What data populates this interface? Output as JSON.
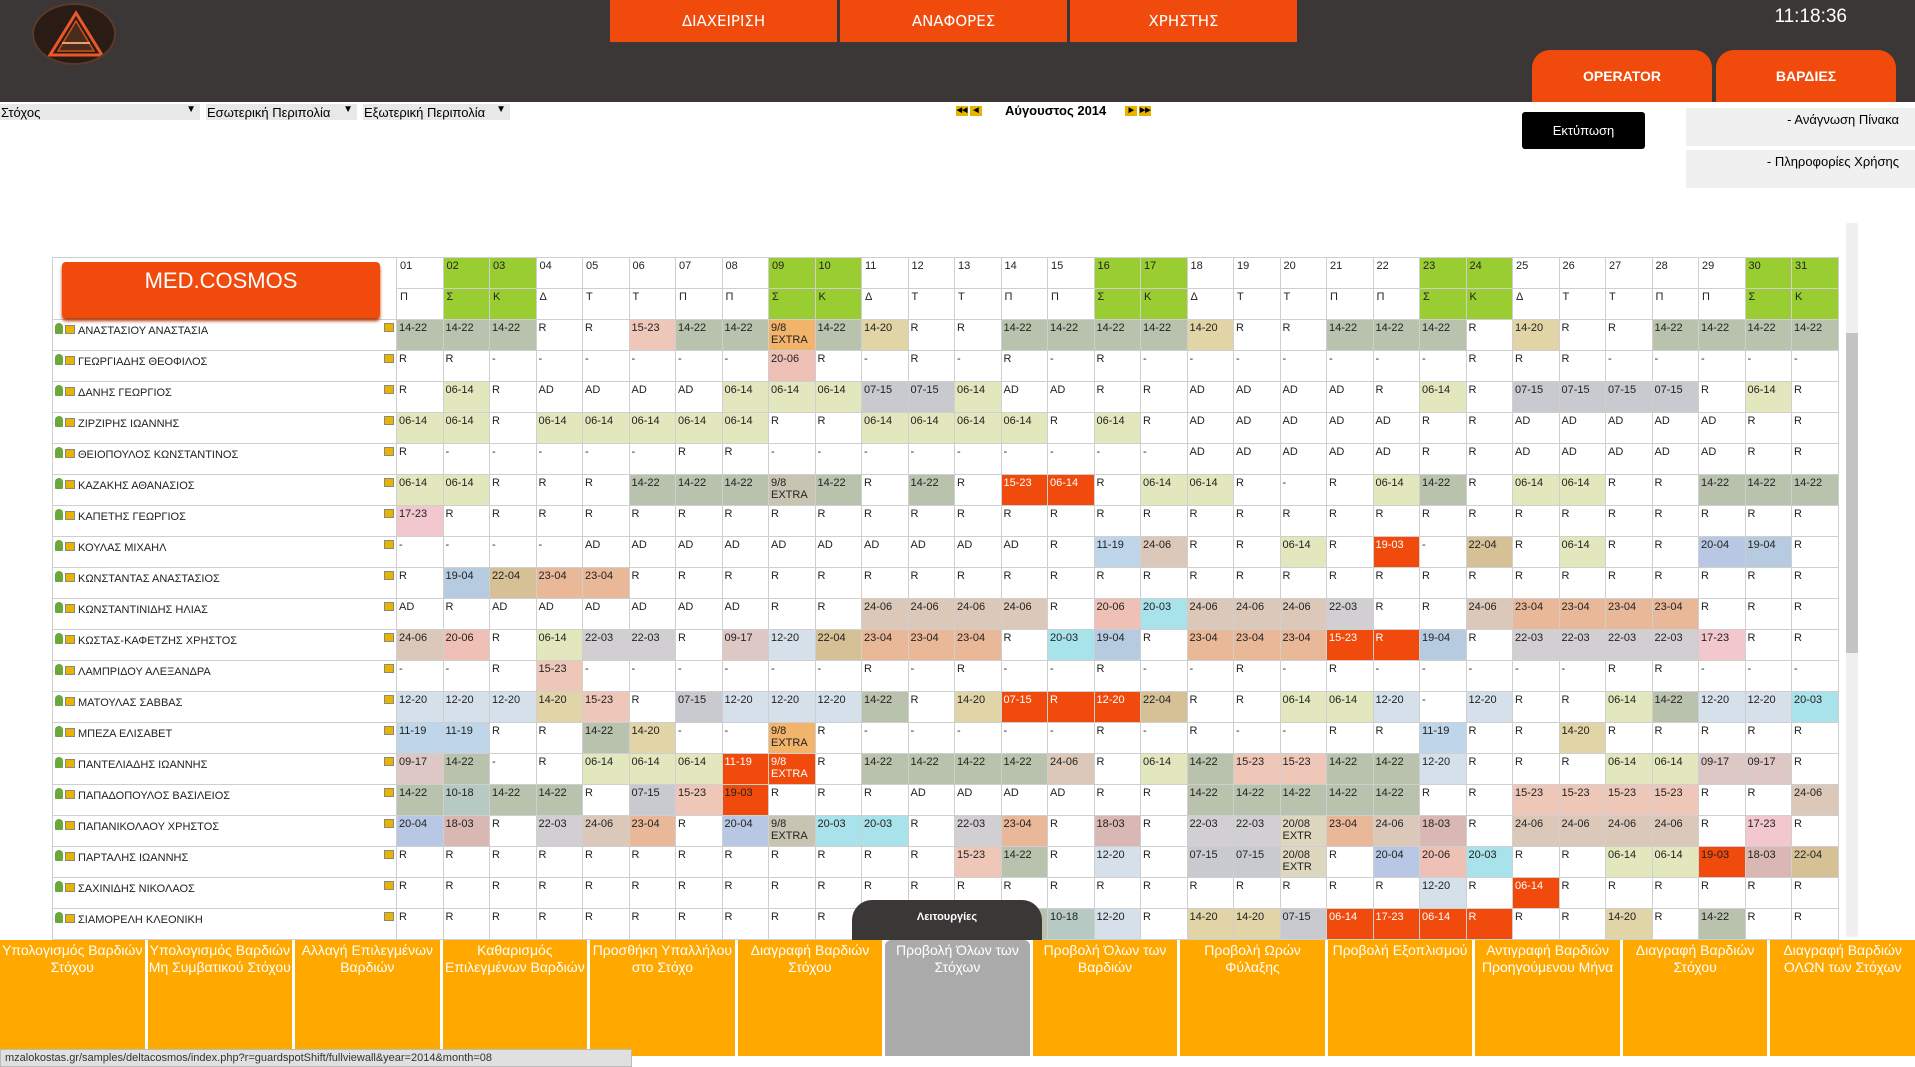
{
  "header": {
    "nav": [
      "ΔΙΑΧΕΙΡΙΣΗ",
      "ΑΝΑΦΟΡΕΣ",
      "ΧΡΗΣΤΗΣ"
    ],
    "clock": "11:18:36",
    "tab_operator": "OPERATOR",
    "tab_shifts": "ΒΑΡΔΙΕΣ"
  },
  "filters": {
    "target": "Στόχος",
    "internal": "Εσωτερική Περιπολία",
    "external": "Εξωτερική Περιπολία"
  },
  "month": "Αύγουστος 2014",
  "print_label": "Εκτύπωση",
  "right_panel": {
    "read_table": "- Ανάγνωση Πίνακα",
    "usage_info": "- Πληροφορίες Χρήσης"
  },
  "brand": "MED.COSMOS",
  "colors": {
    "orange": "#f04a0c",
    "weekend": "#9acd32",
    "button": "#ffa800",
    "dark": "#3a3736"
  },
  "days": [
    "01",
    "02",
    "03",
    "04",
    "05",
    "06",
    "07",
    "08",
    "09",
    "10",
    "11",
    "12",
    "13",
    "14",
    "15",
    "16",
    "17",
    "18",
    "19",
    "20",
    "21",
    "22",
    "23",
    "24",
    "25",
    "26",
    "27",
    "28",
    "29",
    "30",
    "31"
  ],
  "weekdays": [
    "Π",
    "Σ",
    "Κ",
    "Δ",
    "Τ",
    "Τ",
    "Π",
    "Π",
    "Σ",
    "Κ",
    "Δ",
    "Τ",
    "Τ",
    "Π",
    "Π",
    "Σ",
    "Κ",
    "Δ",
    "Τ",
    "Τ",
    "Π",
    "Π",
    "Σ",
    "Κ",
    "Δ",
    "Τ",
    "Τ",
    "Π",
    "Π",
    "Σ",
    "Κ"
  ],
  "weekend_cols": [
    1,
    2,
    8,
    9,
    15,
    16,
    22,
    23,
    29,
    30
  ],
  "employees": [
    {
      "name": "ΑΝΑΣΤΑΣΙΟΥ ΑΝΑΣΤΑΣΙΑ",
      "cells": [
        "14-22",
        "14-22",
        "14-22",
        "R",
        "R",
        "15-23",
        "14-22",
        "14-22",
        "9/8|EXTRA",
        "14-22",
        "14-20",
        "R",
        "R",
        "14-22",
        "14-22",
        "14-22",
        "14-22",
        "14-20",
        "R",
        "R",
        "14-22",
        "14-22",
        "14-22",
        "R",
        "14-20",
        "R",
        "R",
        "14-22",
        "14-22",
        "14-22",
        "14-22"
      ]
    },
    {
      "name": "ΓΕΩΡΓΙΑΔΗΣ ΘΕΟΦΙΛΟΣ",
      "cells": [
        "R",
        "R",
        "-",
        "-",
        "-",
        "-",
        "-",
        "-",
        "20-06",
        "R",
        "-",
        "R",
        "-",
        "R",
        "-",
        "R",
        "-",
        "-",
        "-",
        "-",
        "-",
        "-",
        "-",
        "R",
        "R",
        "R",
        "-",
        "-",
        "-",
        "-",
        "-"
      ]
    },
    {
      "name": "ΔΑΝΗΣ ΓΕΩΡΓΙΟΣ",
      "cells": [
        "R",
        "06-14",
        "R",
        "AD",
        "AD",
        "AD",
        "AD",
        "06-14",
        "06-14",
        "06-14",
        "07-15",
        "07-15",
        "06-14",
        "AD",
        "AD",
        "R",
        "R",
        "AD",
        "AD",
        "AD",
        "AD",
        "R",
        "06-14",
        "R",
        "07-15",
        "07-15",
        "07-15",
        "07-15",
        "R",
        "06-14",
        "R"
      ]
    },
    {
      "name": "ΖΙΡΖΙΡΗΣ ΙΩΑΝΝΗΣ",
      "cells": [
        "06-14",
        "06-14",
        "R",
        "06-14",
        "06-14",
        "06-14",
        "06-14",
        "06-14",
        "R",
        "R",
        "06-14",
        "06-14",
        "06-14",
        "06-14",
        "R",
        "06-14",
        "R",
        "AD",
        "AD",
        "AD",
        "AD",
        "AD",
        "R",
        "R",
        "AD",
        "AD",
        "AD",
        "AD",
        "AD",
        "R",
        "R"
      ]
    },
    {
      "name": "ΘΕΙΟΠΟΥΛΟΣ ΚΩΝΣΤΑΝΤΙΝΟΣ",
      "cells": [
        "R",
        "-",
        "-",
        "-",
        "-",
        "-",
        "R",
        "R",
        "-",
        "-",
        "-",
        "-",
        "-",
        "-",
        "-",
        "-",
        "-",
        "AD",
        "AD",
        "AD",
        "AD",
        "AD",
        "R",
        "R",
        "AD",
        "AD",
        "AD",
        "AD",
        "AD",
        "R",
        "R"
      ]
    },
    {
      "name": "ΚΑΖΑΚΗΣ ΑΘΑΝΑΣΙΟΣ",
      "cells": [
        "06-14",
        "06-14",
        "R",
        "R",
        "R",
        "14-22",
        "14-22",
        "14-22",
        "9/8|EXTRA",
        "14-22",
        "R",
        "14-22",
        "R",
        "15-23",
        "06-14",
        "R",
        "06-14",
        "06-14",
        "R",
        "-",
        "R",
        "06-14",
        "14-22",
        "R",
        "06-14",
        "06-14",
        "R",
        "R",
        "14-22",
        "14-22",
        "14-22"
      ]
    },
    {
      "name": "ΚΑΠΕΤΗΣ ΓΕΩΡΓΙΟΣ",
      "cells": [
        "17-23",
        "R",
        "R",
        "R",
        "R",
        "R",
        "R",
        "R",
        "R",
        "R",
        "R",
        "R",
        "R",
        "R",
        "R",
        "R",
        "R",
        "R",
        "R",
        "R",
        "R",
        "R",
        "R",
        "R",
        "R",
        "R",
        "R",
        "R",
        "R",
        "R",
        "R"
      ]
    },
    {
      "name": "ΚΟΥΛΑΣ ΜΙΧΑΗΛ",
      "cells": [
        "-",
        "-",
        "-",
        "-",
        "AD",
        "AD",
        "AD",
        "AD",
        "AD",
        "AD",
        "AD",
        "AD",
        "AD",
        "AD",
        "R",
        "11-19",
        "24-06",
        "R",
        "R",
        "06-14",
        "R",
        "19-03",
        "-",
        "22-04",
        "R",
        "06-14",
        "R",
        "R",
        "20-04",
        "19-04",
        "R"
      ]
    },
    {
      "name": "ΚΩΝΣΤΑΝΤΑΣ ΑΝΑΣΤΑΣΙΟΣ",
      "cells": [
        "R",
        "19-04",
        "22-04",
        "23-04",
        "23-04",
        "R",
        "R",
        "R",
        "R",
        "R",
        "R",
        "R",
        "R",
        "R",
        "R",
        "R",
        "R",
        "R",
        "R",
        "R",
        "R",
        "R",
        "R",
        "R",
        "R",
        "R",
        "R",
        "R",
        "R",
        "R",
        "R"
      ]
    },
    {
      "name": "ΚΩΝΣΤΑΝΤΙΝΙΔΗΣ ΗΛΙΑΣ",
      "cells": [
        "AD",
        "R",
        "AD",
        "AD",
        "AD",
        "AD",
        "AD",
        "AD",
        "R",
        "R",
        "24-06",
        "24-06",
        "24-06",
        "24-06",
        "R",
        "20-06",
        "20-03",
        "24-06",
        "24-06",
        "24-06",
        "22-03",
        "R",
        "R",
        "24-06",
        "23-04",
        "23-04",
        "23-04",
        "23-04",
        "R",
        "R",
        "R"
      ]
    },
    {
      "name": "ΚΩΣΤΑΣ-ΚΑΦΕΤΖΗΣ ΧΡΗΣΤΟΣ",
      "cells": [
        "24-06",
        "20-06",
        "R",
        "06-14",
        "22-03",
        "22-03",
        "R",
        "09-17",
        "12-20",
        "22-04",
        "23-04",
        "23-04",
        "23-04",
        "R",
        "20-03",
        "19-04",
        "R",
        "23-04",
        "23-04",
        "23-04",
        "15-23",
        "R",
        "19-04",
        "R",
        "22-03",
        "22-03",
        "22-03",
        "22-03",
        "17-23",
        "R",
        "R"
      ]
    },
    {
      "name": "ΛΑΜΠΡΙΔΟΥ ΑΛΕΞΑΝΔΡΑ",
      "cells": [
        "-",
        "-",
        "R",
        "15-23",
        "-",
        "-",
        "-",
        "-",
        "-",
        "-",
        "R",
        "-",
        "R",
        "-",
        "-",
        "R",
        "-",
        "-",
        "R",
        "-",
        "R",
        "-",
        "-",
        "-",
        "-",
        "-",
        "R",
        "R",
        "-",
        "-",
        "-"
      ]
    },
    {
      "name": "ΜΑΤΟΥΛΑΣ ΣΑΒΒΑΣ",
      "cells": [
        "12-20",
        "12-20",
        "12-20",
        "14-20",
        "15-23",
        "R",
        "07-15",
        "12-20",
        "12-20",
        "12-20",
        "14-22",
        "R",
        "14-20",
        "07-15",
        "R",
        "12-20",
        "22-04",
        "R",
        "R",
        "06-14",
        "06-14",
        "12-20",
        "-",
        "12-20",
        "R",
        "R",
        "06-14",
        "14-22",
        "12-20",
        "12-20",
        "20-03"
      ]
    },
    {
      "name": "ΜΠΕΖΑ ΕΛΙΣΑΒΕΤ",
      "cells": [
        "11-19",
        "11-19",
        "R",
        "R",
        "14-22",
        "14-20",
        "-",
        "-",
        "9/8|EXTRA",
        "R",
        "-",
        "-",
        "-",
        "-",
        "-",
        "R",
        "-",
        "R",
        "-",
        "-",
        "R",
        "R",
        "11-19",
        "R",
        "R",
        "14-20",
        "R",
        "R",
        "R",
        "R",
        "R"
      ]
    },
    {
      "name": "ΠΑΝΤΕΛΙΑΔΗΣ ΙΩΑΝΝΗΣ",
      "cells": [
        "09-17",
        "14-22",
        "-",
        "R",
        "06-14",
        "06-14",
        "06-14",
        "11-19",
        "9/8|EXTRA",
        "R",
        "14-22",
        "14-22",
        "14-22",
        "14-22",
        "24-06",
        "R",
        "06-14",
        "14-22",
        "15-23",
        "15-23",
        "14-22",
        "14-22",
        "12-20",
        "R",
        "R",
        "R",
        "06-14",
        "06-14",
        "09-17",
        "09-17",
        "R"
      ]
    },
    {
      "name": "ΠΑΠΑΔΟΠΟΥΛΟΣ ΒΑΣΙΛΕΙΟΣ",
      "cells": [
        "14-22",
        "10-18",
        "14-22",
        "14-22",
        "R",
        "07-15",
        "15-23",
        "19-03",
        "R",
        "R",
        "R",
        "AD",
        "AD",
        "AD",
        "AD",
        "R",
        "R",
        "14-22",
        "14-22",
        "14-22",
        "14-22",
        "14-22",
        "R",
        "R",
        "15-23",
        "15-23",
        "15-23",
        "15-23",
        "R",
        "R",
        "24-06"
      ]
    },
    {
      "name": "ΠΑΠΑΝΙΚΟΛΑΟΥ ΧΡΗΣΤΟΣ",
      "cells": [
        "20-04",
        "18-03",
        "R",
        "22-03",
        "24-06",
        "23-04",
        "R",
        "20-04",
        "9/8|EXTRA",
        "20-03",
        "20-03",
        "R",
        "22-03",
        "23-04",
        "R",
        "18-03",
        "R",
        "22-03",
        "22-03",
        "20/08|EXTR",
        "23-04",
        "24-06",
        "18-03",
        "R",
        "24-06",
        "24-06",
        "24-06",
        "24-06",
        "R",
        "17-23",
        "R"
      ]
    },
    {
      "name": "ΠΑΡΤΑΛΗΣ ΙΩΑΝΝΗΣ",
      "cells": [
        "R",
        "R",
        "R",
        "R",
        "R",
        "R",
        "R",
        "R",
        "R",
        "R",
        "R",
        "R",
        "15-23",
        "14-22",
        "R",
        "12-20",
        "R",
        "07-15",
        "07-15",
        "20/08|EXTR",
        "R",
        "20-04",
        "20-06",
        "20-03",
        "R",
        "R",
        "06-14",
        "06-14",
        "19-03",
        "18-03",
        "22-04"
      ]
    },
    {
      "name": "ΣΑΧΙΝΙΔΗΣ ΝΙΚΟΛΑΟΣ",
      "cells": [
        "R",
        "R",
        "R",
        "R",
        "R",
        "R",
        "R",
        "R",
        "R",
        "R",
        "R",
        "R",
        "R",
        "R",
        "R",
        "R",
        "R",
        "R",
        "R",
        "R",
        "R",
        "R",
        "12-20",
        "R",
        "06-14",
        "R",
        "R",
        "R",
        "R",
        "R",
        "R"
      ]
    },
    {
      "name": "ΣΙΑΜΟΡΕΛΗ ΚΛΕΟΝΙΚΗ",
      "cells": [
        "R",
        "R",
        "R",
        "R",
        "R",
        "R",
        "R",
        "R",
        "R",
        "R",
        "R",
        "R",
        "R",
        "14-22",
        "10-18",
        "12-20",
        "R",
        "14-20",
        "14-20",
        "07-15",
        "06-14",
        "17-23",
        "06-14",
        "R",
        "R",
        "R",
        "14-20",
        "R",
        "14-22",
        "R",
        "R"
      ]
    }
  ],
  "function_tab": "Λειτουργίες",
  "buttons": [
    "Υπολογισμός Βαρδιών Στόχου",
    "Υπολογισμός Βαρδιών Μη Συμβατικού Στόχου",
    "Αλλαγή Επιλεγμένων Βαρδιών",
    "Καθαρισμός Επιλεγμένων Βαρδιών",
    "Προσθήκη Υπαλλήλου στο Στόχο",
    "Διαγραφή Βαρδιών Στόχου",
    "Προβολή Όλων των Στόχων",
    "Προβολή Όλων των Βαρδιών",
    "Προβολή Ωρών Φύλαξης",
    "Προβολή Εξοπλισμού",
    "Αντιγραφή Βαρδιών Προηγούμενου Μήνα",
    "Διαγραφή Βαρδιών Στόχου",
    "Διαγραφή Βαρδιών ΟΛΩΝ των Στόχων"
  ],
  "active_button": 6,
  "status_url": "mzalokostas.gr/samples/deltacosmos/index.php?r=guardspotShift/fullviewall&year=2014&month=08",
  "shift_colors": {
    "14-22": "#b9c2ad",
    "14-20": "#e1d5a8",
    "15-23": "#efc7b8",
    "9/8": "#c9a3b4",
    "20-06": "#efc0b5",
    "06-14": "#e2e7bd",
    "07-15": "#c9cad0",
    "17-23": "#f2c7cd",
    "11-19": "#bfd6ea",
    "24-06": "#dcc8b8",
    "19-03": "#f04a0c",
    "22-04": "#d6c095",
    "19-04": "#b7cbe0",
    "23-04": "#e9b899",
    "20-03": "#a8e2ea",
    "22-03": "#d1cfd1",
    "09-17": "#ddc8c5",
    "12-20": "#d6e0ea",
    "10-18": "#b6c9c3",
    "18-03": "#d9b7b2",
    "20-04": "#b8c8e4",
    "20/08": "#ded7c0",
    "AD": "#ffffff",
    "R": "#ffffff",
    "-": "#ffffff"
  },
  "hot_cells": [
    "5:13",
    "5:14",
    "7:21",
    "10:20",
    "10:21",
    "12:13",
    "12:14",
    "12:15",
    "14:7",
    "14:8",
    "18:24",
    "19:20",
    "19:21",
    "19:22",
    "19:23"
  ]
}
